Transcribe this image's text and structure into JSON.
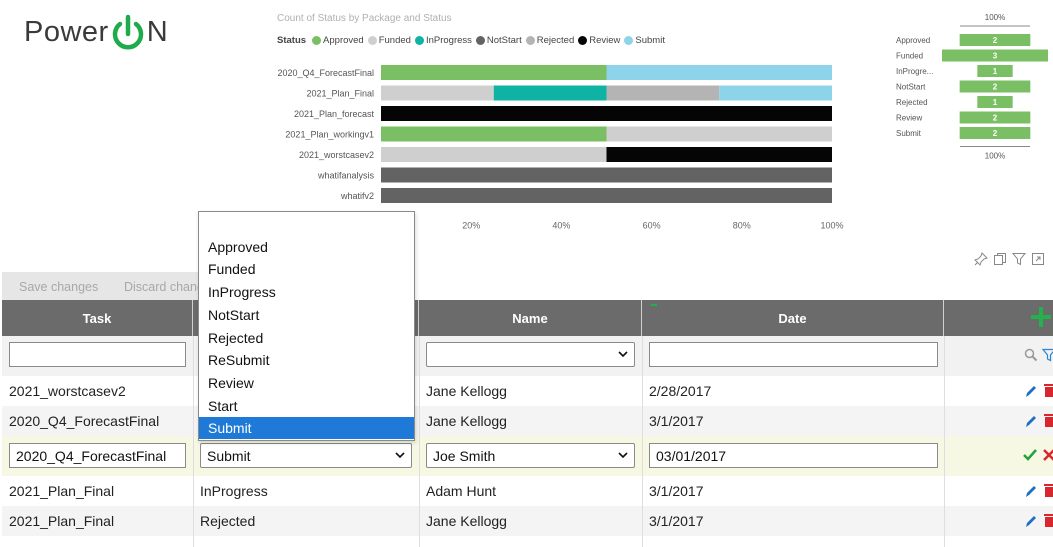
{
  "logo": {
    "text_left": "Power",
    "text_right": "N",
    "icon": "power-icon"
  },
  "chart_data": [
    {
      "type": "bar",
      "orientation": "horizontal",
      "stacked": "percent",
      "title": "Count of Status by Package and Status",
      "legend_title": "Status",
      "legend_position": "top",
      "categories": [
        "2020_Q4_ForecastFinal",
        "2021_Plan_Final",
        "2021_Plan_forecast",
        "2021_Plan_workingv1",
        "2021_worstcasev2",
        "whatifanalysis",
        "whatifv2"
      ],
      "series": [
        {
          "name": "Approved",
          "color": "#7bbf65",
          "values": [
            50,
            0,
            0,
            50,
            0,
            0,
            0
          ]
        },
        {
          "name": "Funded",
          "color": "#cfcfcf",
          "values": [
            0,
            25,
            0,
            50,
            50,
            0,
            0
          ]
        },
        {
          "name": "InProgress",
          "color": "#0fb3a4",
          "values": [
            0,
            25,
            0,
            0,
            0,
            0,
            0
          ]
        },
        {
          "name": "NotStart",
          "color": "#636363",
          "values": [
            0,
            0,
            0,
            0,
            0,
            100,
            100
          ]
        },
        {
          "name": "Rejected",
          "color": "#b4b4b4",
          "values": [
            0,
            25,
            0,
            0,
            0,
            0,
            0
          ]
        },
        {
          "name": "Review",
          "color": "#050505",
          "values": [
            0,
            0,
            100,
            0,
            50,
            0,
            0
          ]
        },
        {
          "name": "Submit",
          "color": "#8dd3ea",
          "values": [
            50,
            25,
            0,
            0,
            0,
            0,
            0
          ]
        }
      ],
      "x_ticks": [
        "20%",
        "40%",
        "60%",
        "80%",
        "100%"
      ],
      "xlim": [
        0,
        100
      ],
      "grid": false
    },
    {
      "type": "bar",
      "orientation": "horizontal",
      "title": "",
      "top_label": "100%",
      "bottom_label": "100%",
      "color": "#7bbf65",
      "categories": [
        "Approved",
        "Funded",
        "InProgre...",
        "NotStart",
        "Rejected",
        "Review",
        "Submit"
      ],
      "values": [
        2,
        3,
        1,
        2,
        1,
        2,
        2
      ],
      "data_labels": [
        "2",
        "3",
        "1",
        "2",
        "1",
        "2",
        "2"
      ],
      "xlim": [
        0,
        3
      ]
    }
  ],
  "toolbar_icons": [
    "pin-icon",
    "copy-icon",
    "filter-icon",
    "focus-mode-icon"
  ],
  "actions": {
    "save_label": "Save changes",
    "discard_label": "Discard chang"
  },
  "columns": {
    "task": "Task",
    "status": "",
    "name": "Name",
    "date": "Date"
  },
  "add_icon": "plus-icon",
  "filters": {
    "task_value": "",
    "name_value": "",
    "date_value": ""
  },
  "rows": [
    {
      "task": "2021_worstcasev2",
      "status": "",
      "name": "Jane Kellogg",
      "date": "2/28/2017"
    },
    {
      "task": "2020_Q4_ForecastFinal",
      "status": "",
      "name": "Jane Kellogg",
      "date": "3/1/2017"
    }
  ],
  "edit_row": {
    "task": "2020_Q4_ForecastFinal",
    "status": "Submit",
    "name": "Joe Smith",
    "date": "03/01/2017"
  },
  "rows_after": [
    {
      "task": "2021_Plan_Final",
      "status": "InProgress",
      "name": "Adam Hunt",
      "date": "3/1/2017"
    },
    {
      "task": "2021_Plan_Final",
      "status": "Rejected",
      "name": "Jane Kellogg",
      "date": "3/1/2017"
    }
  ],
  "status_dropdown": {
    "options": [
      "",
      "Approved",
      "Funded",
      "InProgress",
      "NotStart",
      "Rejected",
      "ReSubmit",
      "Review",
      "Start",
      "Submit"
    ],
    "selected": "Submit"
  },
  "colors": {
    "header_bg": "#6b6b6b",
    "accent_green": "#22b14c",
    "edit_blue": "#1e6fc2",
    "delete_red": "#d9262e",
    "selection_blue": "#1e7ad6"
  }
}
